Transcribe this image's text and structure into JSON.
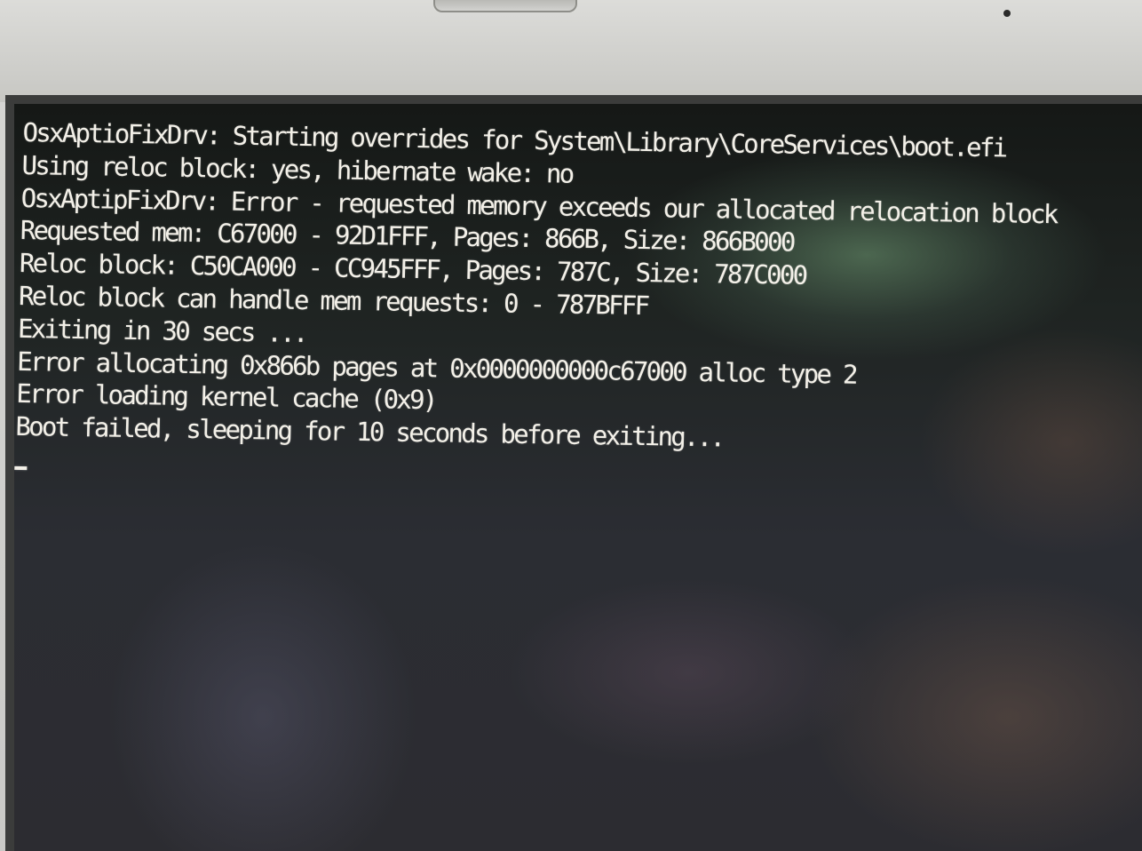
{
  "terminal": {
    "lines": [
      "OsxAptioFixDrv: Starting overrides for System\\Library\\CoreServices\\boot.efi",
      "Using reloc block: yes, hibernate wake: no",
      "OsxAptipFixDrv: Error - requested memory exceeds our allocated relocation block",
      "Requested mem: C67000 - 92D1FFF, Pages: 866B, Size: 866B000",
      "Reloc block: C50CA000 - CC945FFF, Pages: 787C, Size: 787C000",
      "Reloc block can handle mem requests: 0 - 787BFFF",
      "Exiting in 30 secs ...",
      "Error allocating 0x866b pages at 0x0000000000c67000 alloc type 2",
      "Error loading kernel cache (0x9)",
      "Boot failed, sleeping for 10 seconds before exiting..."
    ]
  },
  "icons": {
    "cursor": "text-cursor-icon",
    "camera": "camera-icon"
  },
  "colors": {
    "text": "#f3f0e8",
    "screen_dark": "#1f2422",
    "bezel": "#d6d6d3"
  }
}
